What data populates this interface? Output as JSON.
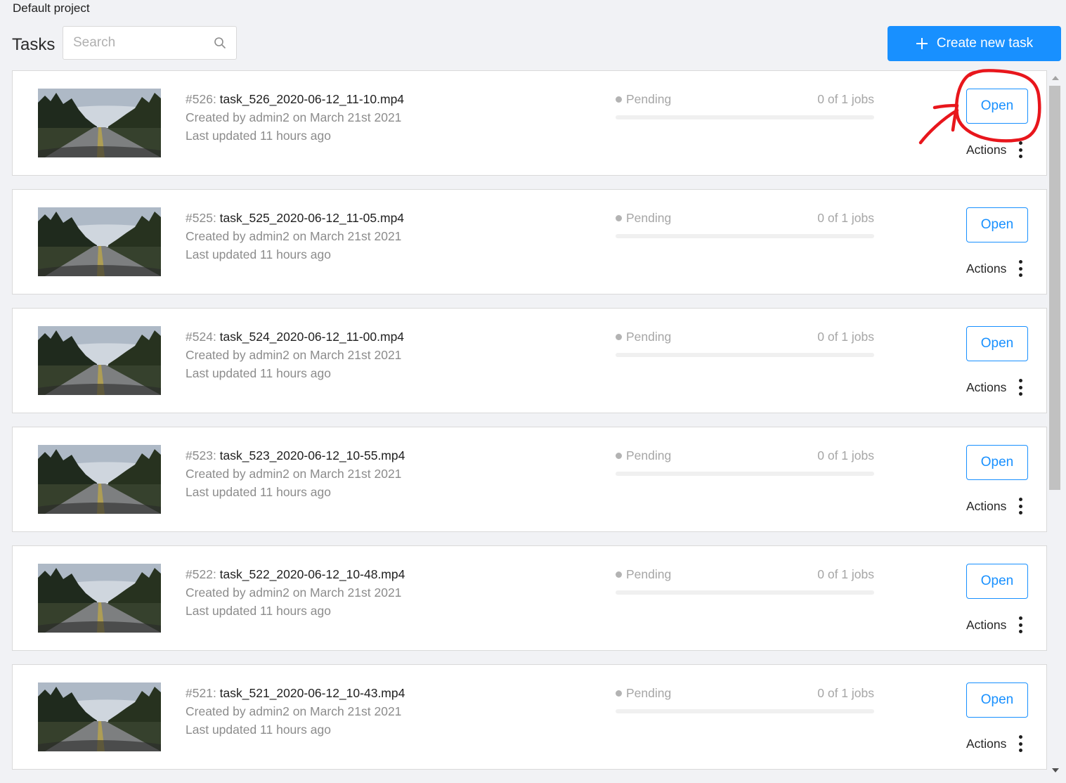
{
  "header": {
    "project_title": "Default project",
    "page_title": "Tasks",
    "search_placeholder": "Search",
    "create_button_label": "Create new task"
  },
  "tasks": [
    {
      "id": "#526",
      "name": "task_526_2020-06-12_11-10.mp4",
      "created": "Created by admin2 on March 21st 2021",
      "updated": "Last updated 11 hours ago",
      "status": "Pending",
      "jobs": "0 of 1 jobs",
      "progress": 0,
      "open_label": "Open",
      "actions_label": "Actions"
    },
    {
      "id": "#525",
      "name": "task_525_2020-06-12_11-05.mp4",
      "created": "Created by admin2 on March 21st 2021",
      "updated": "Last updated 11 hours ago",
      "status": "Pending",
      "jobs": "0 of 1 jobs",
      "progress": 0,
      "open_label": "Open",
      "actions_label": "Actions"
    },
    {
      "id": "#524",
      "name": "task_524_2020-06-12_11-00.mp4",
      "created": "Created by admin2 on March 21st 2021",
      "updated": "Last updated 11 hours ago",
      "status": "Pending",
      "jobs": "0 of 1 jobs",
      "progress": 0,
      "open_label": "Open",
      "actions_label": "Actions"
    },
    {
      "id": "#523",
      "name": "task_523_2020-06-12_10-55.mp4",
      "created": "Created by admin2 on March 21st 2021",
      "updated": "Last updated 11 hours ago",
      "status": "Pending",
      "jobs": "0 of 1 jobs",
      "progress": 0,
      "open_label": "Open",
      "actions_label": "Actions"
    },
    {
      "id": "#522",
      "name": "task_522_2020-06-12_10-48.mp4",
      "created": "Created by admin2 on March 21st 2021",
      "updated": "Last updated 11 hours ago",
      "status": "Pending",
      "jobs": "0 of 1 jobs",
      "progress": 0,
      "open_label": "Open",
      "actions_label": "Actions"
    },
    {
      "id": "#521",
      "name": "task_521_2020-06-12_10-43.mp4",
      "created": "Created by admin2 on March 21st 2021",
      "updated": "Last updated 11 hours ago",
      "status": "Pending",
      "jobs": "0 of 1 jobs",
      "progress": 0,
      "open_label": "Open",
      "actions_label": "Actions"
    }
  ],
  "colors": {
    "accent": "#1890ff",
    "annotation": "#e8161c",
    "pending_dot": "#b3b3b3"
  },
  "icons": {
    "search": "search-icon",
    "plus": "plus-icon",
    "more": "kebab-icon"
  }
}
